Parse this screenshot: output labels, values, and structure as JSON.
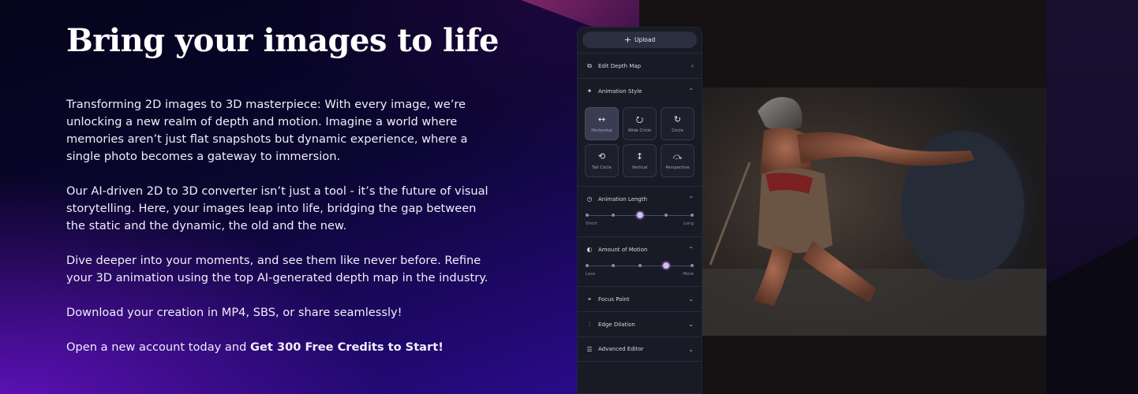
{
  "hero": {
    "headline": "Bring your images to life",
    "paragraphs": [
      "Transforming 2D images to 3D masterpiece: With every image, we’re unlocking a new realm of depth and motion. Imagine a world where memories aren’t just flat snapshots but dynamic experience, where a single photo becomes a gateway to immersion.",
      "Our AI-driven 2D to 3D converter isn’t just a tool - it’s the future of visual storytelling. Here, your images leap into life, bridging the gap between the static and the dynamic, the old and the new.",
      "Dive deeper into your moments, and see them like never before. Refine your 3D animation using the top AI-generated depth map in the industry.",
      "Download your creation in MP4, SBS, or share seamlessly!"
    ],
    "cta_prefix": "Open a new account today and ",
    "cta_bold": "Get 300 Free Credits to Start!"
  },
  "editor": {
    "upload_label": "Upload",
    "sections": {
      "edit_depth_map": "Edit Depth Map",
      "animation_style": "Animation Style",
      "animation_length": "Animation Length",
      "amount_of_motion": "Amount of Motion",
      "focus_point": "Focus Point",
      "edge_dilation": "Edge Dilation",
      "advanced_editor": "Advanced Editor"
    },
    "styles": [
      {
        "label": "Horizontal",
        "icon": "horizontal-arrows-icon",
        "selected": true
      },
      {
        "label": "Wide Circle",
        "icon": "wide-circle-icon",
        "selected": false
      },
      {
        "label": "Circle",
        "icon": "circle-icon",
        "selected": false
      },
      {
        "label": "Tall Circle",
        "icon": "tall-circle-icon",
        "selected": false
      },
      {
        "label": "Vertical",
        "icon": "vertical-arrows-icon",
        "selected": false
      },
      {
        "label": "Perspective",
        "icon": "perspective-icon",
        "selected": false
      }
    ],
    "animation_length": {
      "min_label": "Short",
      "max_label": "Long",
      "steps": 5,
      "value_index": 2
    },
    "amount_of_motion": {
      "min_label": "Less",
      "max_label": "More",
      "steps": 5,
      "value_index": 3
    }
  },
  "colors": {
    "accent": "#d9b8ff",
    "panel": "#181a26"
  }
}
